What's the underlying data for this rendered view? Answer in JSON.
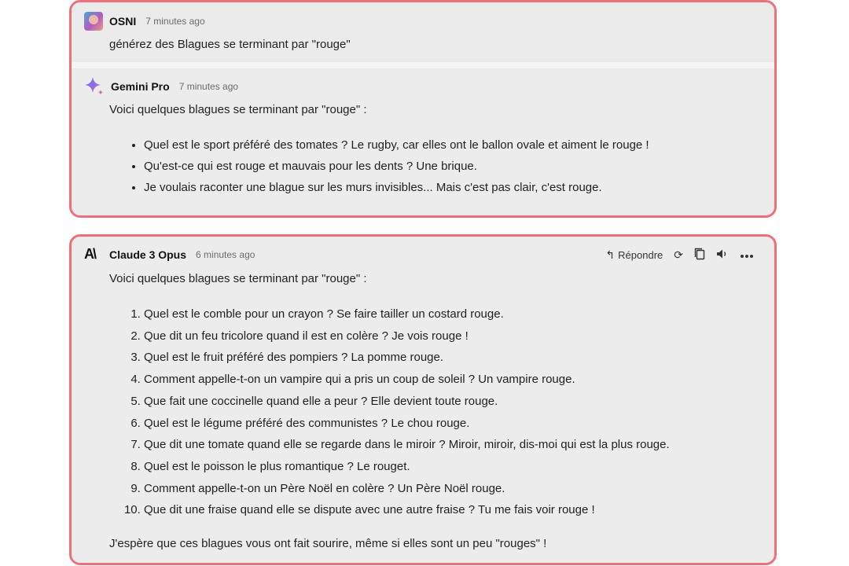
{
  "conversation1": {
    "user_message": {
      "author": "OSNI",
      "time": "7 minutes ago",
      "text": "générez des Blagues se terminant par \"rouge\""
    },
    "bot_message": {
      "author": "Gemini Pro",
      "time": "7 minutes ago",
      "intro": "Voici quelques blagues se terminant par \"rouge\" :",
      "items": [
        "Quel est le sport préféré des tomates ? Le rugby, car elles ont le ballon ovale et aiment le rouge !",
        "Qu'est-ce qui est rouge et mauvais pour les dents ? Une brique.",
        "Je voulais raconter une blague sur les murs invisibles... Mais c'est pas clair, c'est rouge."
      ]
    }
  },
  "conversation2": {
    "bot_message": {
      "author": "Claude 3 Opus",
      "time": "6 minutes ago",
      "icon_text": "A\\",
      "reply_label": "Répondre",
      "intro": "Voici quelques blagues se terminant par \"rouge\" :",
      "items": [
        "Quel est le comble pour un crayon ? Se faire tailler un costard rouge.",
        "Que dit un feu tricolore quand il est en colère ? Je vois rouge !",
        "Quel est le fruit préféré des pompiers ? La pomme rouge.",
        "Comment appelle-t-on un vampire qui a pris un coup de soleil ? Un vampire rouge.",
        "Que fait une coccinelle quand elle a peur ? Elle devient toute rouge.",
        "Quel est le légume préféré des communistes ? Le chou rouge.",
        "Que dit une tomate quand elle se regarde dans le miroir ? Miroir, miroir, dis-moi qui est la plus rouge.",
        "Quel est le poisson le plus romantique ? Le rouget.",
        "Comment appelle-t-on un Père Noël en colère ? Un Père Noël rouge.",
        "Que dit une fraise quand elle se dispute avec une autre fraise ? Tu me fais voir rouge !"
      ],
      "outro": "J'espère que ces blagues vous ont fait sourire, même si elles sont un peu \"rouges\" !"
    }
  },
  "colors": {
    "card_border": "#ec6f7a",
    "card_background": "#f1f1f1"
  },
  "icons": {
    "reply": "reply-arrow-icon",
    "regenerate": "refresh-icon",
    "copy": "copy-icon",
    "speak": "speaker-icon",
    "more": "more-icon"
  }
}
